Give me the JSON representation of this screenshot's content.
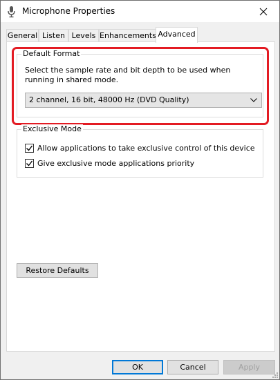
{
  "window": {
    "title": "Microphone Properties",
    "icon": "microphone-icon"
  },
  "tabs": [
    {
      "label": "General",
      "active": false
    },
    {
      "label": "Listen",
      "active": false
    },
    {
      "label": "Levels",
      "active": false
    },
    {
      "label": "Enhancements",
      "active": false
    },
    {
      "label": "Advanced",
      "active": true
    }
  ],
  "default_format": {
    "group_label": "Default Format",
    "description": "Select the sample rate and bit depth to be used when running in shared mode.",
    "selected_value": "2 channel, 16 bit, 48000 Hz (DVD Quality)"
  },
  "exclusive_mode": {
    "group_label": "Exclusive Mode",
    "options": [
      {
        "label": "Allow applications to take exclusive control of this device",
        "checked": true
      },
      {
        "label": "Give exclusive mode applications priority",
        "checked": true
      }
    ]
  },
  "restore_defaults_label": "Restore Defaults",
  "footer": {
    "ok_label": "OK",
    "cancel_label": "Cancel",
    "apply_label": "Apply"
  },
  "colors": {
    "highlight": "#e31b23",
    "focus": "#0078d7"
  }
}
